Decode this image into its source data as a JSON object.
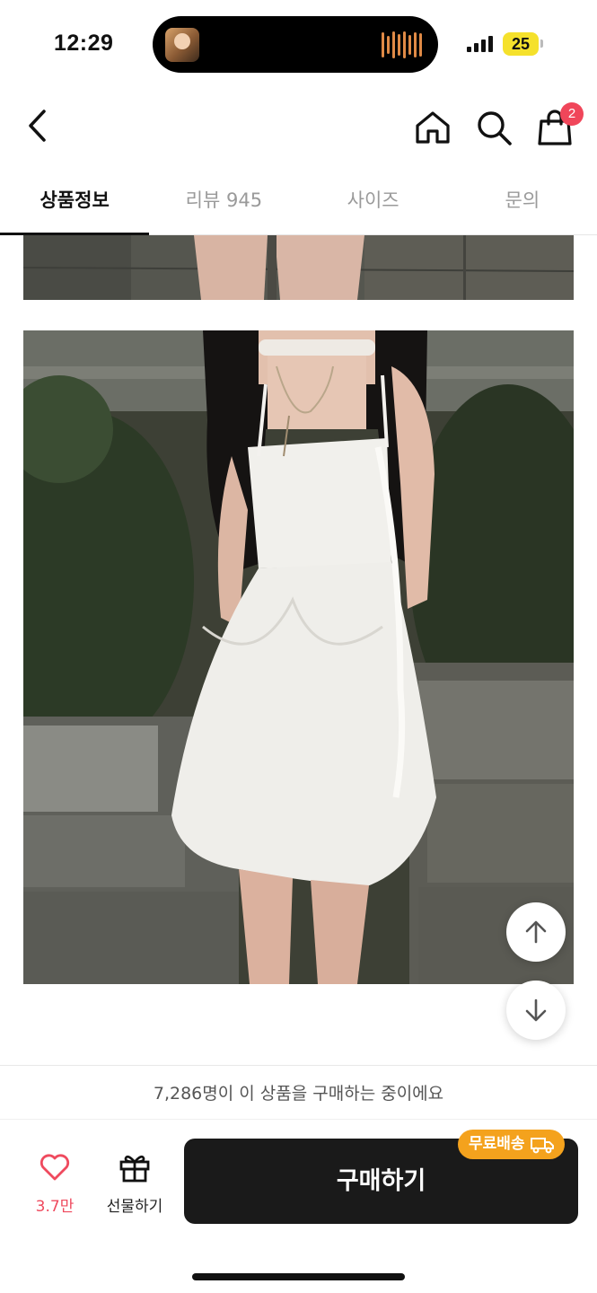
{
  "status_bar": {
    "time": "12:29",
    "battery": "25"
  },
  "header": {
    "back_icon": "chevron-left-icon",
    "home_icon": "home-icon",
    "search_icon": "search-icon",
    "cart_icon": "shopping-bag-icon",
    "cart_count": "2"
  },
  "tabs": [
    {
      "label": "상품정보",
      "active": true
    },
    {
      "label": "리뷰 945",
      "active": false
    },
    {
      "label": "사이즈",
      "active": false
    },
    {
      "label": "문의",
      "active": false
    }
  ],
  "scroll_buttons": {
    "up_icon": "arrow-up-icon",
    "down_icon": "arrow-down-icon"
  },
  "purchase_bar": {
    "buying_notice": "7,286명이 이 상품을 구매하는 중이에요",
    "like_count": "3.7만",
    "gift_label": "선물하기",
    "buy_label": "구매하기",
    "free_shipping_label": "무료배송"
  },
  "colors": {
    "accent_pink": "#f0465a",
    "buy_button": "#1a1a1a",
    "free_shipping": "#f4a21d"
  }
}
